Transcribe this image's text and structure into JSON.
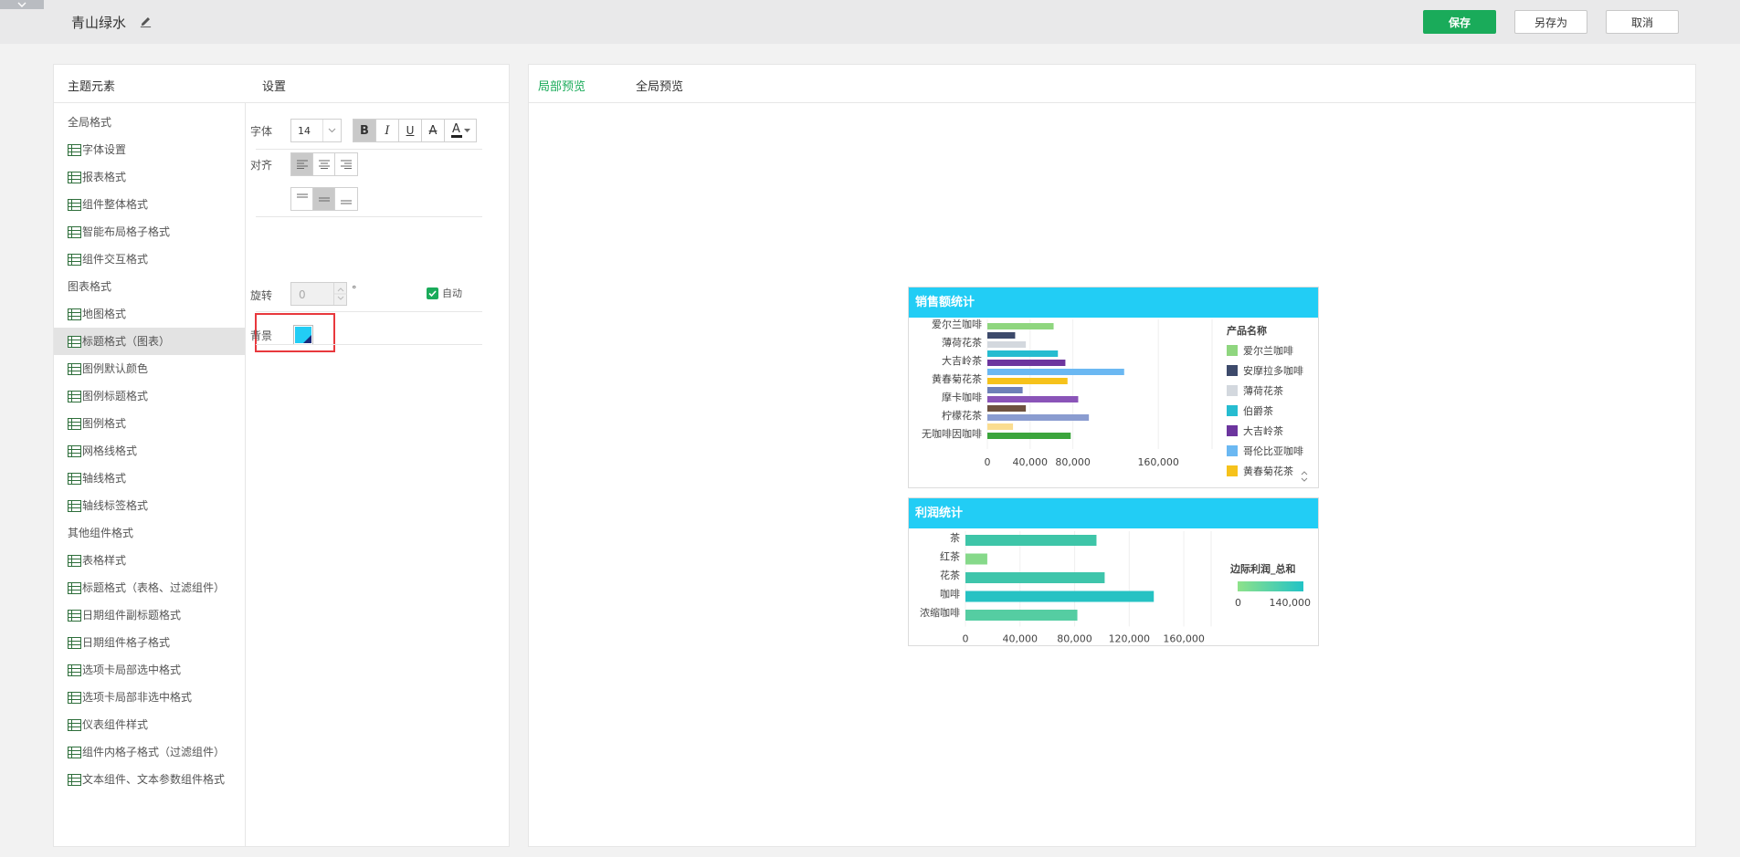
{
  "header": {
    "theme_name": "青山绿水",
    "save_label": "保存",
    "save_as_label": "另存为",
    "cancel_label": "取消"
  },
  "left_panel": {
    "theme_elements_title": "主题元素",
    "settings_title": "设置",
    "tree": [
      {
        "type": "group",
        "label": "全局格式"
      },
      {
        "type": "item",
        "label": "字体设置"
      },
      {
        "type": "item",
        "label": "报表格式"
      },
      {
        "type": "item",
        "label": "组件整体格式"
      },
      {
        "type": "item",
        "label": "智能布局格子格式"
      },
      {
        "type": "item",
        "label": "组件交互格式"
      },
      {
        "type": "group",
        "label": "图表格式"
      },
      {
        "type": "item",
        "label": "地图格式"
      },
      {
        "type": "item",
        "label": "标题格式（图表）",
        "active": true
      },
      {
        "type": "item",
        "label": "图例默认颜色"
      },
      {
        "type": "item",
        "label": "图例标题格式"
      },
      {
        "type": "item",
        "label": "图例格式"
      },
      {
        "type": "item",
        "label": "网格线格式"
      },
      {
        "type": "item",
        "label": "轴线格式"
      },
      {
        "type": "item",
        "label": "轴线标签格式"
      },
      {
        "type": "group",
        "label": "其他组件格式"
      },
      {
        "type": "item",
        "label": "表格样式"
      },
      {
        "type": "item",
        "label": "标题格式（表格、过滤组件）"
      },
      {
        "type": "item",
        "label": "日期组件副标题格式"
      },
      {
        "type": "item",
        "label": "日期组件格子格式"
      },
      {
        "type": "item",
        "label": "选项卡局部选中格式"
      },
      {
        "type": "item",
        "label": "选项卡局部非选中格式"
      },
      {
        "type": "item",
        "label": "仪表组件样式"
      },
      {
        "type": "item",
        "label": "组件内格子格式（过滤组件）"
      },
      {
        "type": "item",
        "label": "文本组件、文本参数组件格式"
      }
    ],
    "settings": {
      "font_label": "字体",
      "font_size": "14",
      "bold": "B",
      "italic": "I",
      "underline": "U",
      "strike": "A",
      "color_a": "A",
      "align_label": "对齐",
      "rotate_label": "旋转",
      "rotate_value": "0",
      "degree": "°",
      "auto_label": "自动",
      "background_label": "背景",
      "background_color": "#22cdf5"
    }
  },
  "right_panel": {
    "tab_local": "局部预览",
    "tab_global": "全局预览"
  },
  "colors": {
    "accent_green": "#1aab5a",
    "title_bar": "#22cdf5",
    "highlight_red": "#e8383d"
  },
  "chart_data": [
    {
      "type": "bar",
      "orientation": "horizontal",
      "title": "销售额统计",
      "categories": [
        "爱尔兰咖啡",
        "薄荷花茶",
        "大吉岭茶",
        "黄春菊花茶",
        "摩卡咖啡",
        "柠檬花茶",
        "无咖啡因咖啡"
      ],
      "bars": [
        {
          "category": "爱尔兰咖啡",
          "series": "爱尔兰咖啡",
          "value": 62000,
          "color": "#8fd67f"
        },
        {
          "category": "爱尔兰咖啡",
          "series": "安摩拉多咖啡",
          "value": 26000,
          "color": "#3d4a6b"
        },
        {
          "category": "薄荷花茶",
          "series": "薄荷花茶",
          "value": 36000,
          "color": "#d3d8de"
        },
        {
          "category": "薄荷花茶",
          "series": "伯爵茶",
          "value": 66000,
          "color": "#26bcd0"
        },
        {
          "category": "大吉岭茶",
          "series": "大吉岭茶",
          "value": 73000,
          "color": "#6c359e"
        },
        {
          "category": "大吉岭茶",
          "series": "哥伦比亚咖啡",
          "value": 128000,
          "color": "#6bb8f2"
        },
        {
          "category": "黄春菊花茶",
          "series": "黄春菊花茶",
          "value": 75000,
          "color": "#f6c21b"
        },
        {
          "category": "黄春菊花茶",
          "series": "",
          "value": 33000,
          "color": "#6e80b8"
        },
        {
          "category": "摩卡咖啡",
          "series": "",
          "value": 85000,
          "color": "#8a54b8"
        },
        {
          "category": "摩卡咖啡",
          "series": "",
          "value": 36000,
          "color": "#6e5240"
        },
        {
          "category": "柠檬花茶",
          "series": "",
          "value": 95000,
          "color": "#8a9cd0"
        },
        {
          "category": "柠檬花茶",
          "series": "",
          "value": 24000,
          "color": "#fbdd90"
        },
        {
          "category": "无咖啡因咖啡",
          "series": "",
          "value": 78000,
          "color": "#3ba53c"
        }
      ],
      "x_ticks": [
        0,
        40000,
        80000,
        160000
      ],
      "x_tick_labels": [
        "0",
        "40,000",
        "80,000",
        "160,000"
      ],
      "xlim": [
        0,
        200000
      ],
      "legend": {
        "title": "产品名称",
        "position": "right",
        "entries": [
          {
            "name": "爱尔兰咖啡",
            "color": "#8fd67f"
          },
          {
            "name": "安摩拉多咖啡",
            "color": "#3d4a6b"
          },
          {
            "name": "薄荷花茶",
            "color": "#d3d8de"
          },
          {
            "name": "伯爵茶",
            "color": "#26bcd0"
          },
          {
            "name": "大吉岭茶",
            "color": "#6c359e"
          },
          {
            "name": "哥伦比亚咖啡",
            "color": "#6bb8f2"
          },
          {
            "name": "黄春菊花茶",
            "color": "#f6c21b"
          }
        ]
      }
    },
    {
      "type": "bar",
      "orientation": "horizontal",
      "title": "利润统计",
      "categories": [
        "茶",
        "红茶",
        "花茶",
        "咖啡",
        "浓缩咖啡"
      ],
      "values": [
        96000,
        16000,
        102000,
        138000,
        82000
      ],
      "colors": [
        "#3ec5a8",
        "#86d98a",
        "#3ec5ab",
        "#26c2c3",
        "#55cda2"
      ],
      "x_ticks": [
        0,
        40000,
        80000,
        120000,
        160000
      ],
      "x_tick_labels": [
        "0",
        "40,000",
        "80,000",
        "120,000",
        "160,000"
      ],
      "xlim": [
        0,
        176000
      ],
      "legend": {
        "title": "边际利润_总和",
        "min_label": "0",
        "max_label": "140,000",
        "gradient": [
          "#8ee28a",
          "#22c3c6"
        ]
      }
    }
  ]
}
